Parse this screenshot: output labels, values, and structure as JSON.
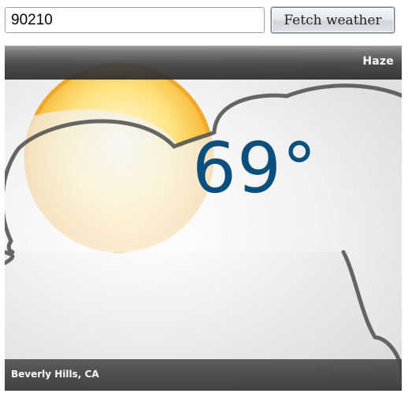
{
  "search": {
    "zip_value": "90210",
    "fetch_label": "Fetch weather"
  },
  "weather": {
    "condition": "Haze",
    "temperature": "69°",
    "location": "Beverly Hills, CA",
    "icon": "sun-behind-cloud-icon"
  },
  "colors": {
    "temperature_text": "#0b4f7e",
    "sun": "#f7b52b",
    "cloud_outline": "#555555",
    "bar_dark": "#2a2a2a"
  }
}
